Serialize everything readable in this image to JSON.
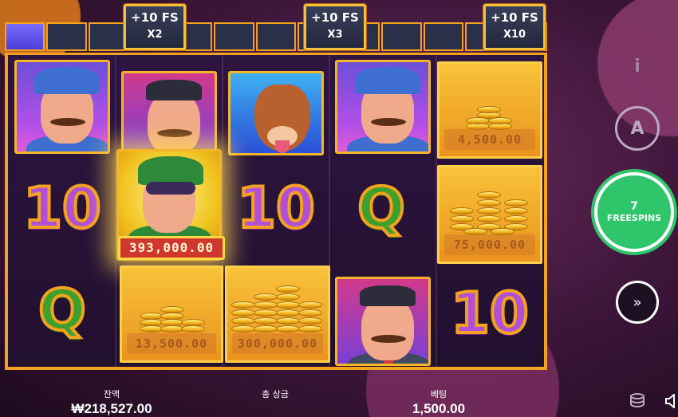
{
  "progress": {
    "filled_cells": 1,
    "total_cells": 13,
    "badges": [
      {
        "label": "+10 FS",
        "multiplier": "X2"
      },
      {
        "label": "+10 FS",
        "multiplier": "X3"
      },
      {
        "label": "+10 FS",
        "multiplier": "X10"
      }
    ]
  },
  "reels": {
    "coin_values": {
      "r1c5": "4,500.00",
      "r2c5": "75,000.00",
      "r3c2": "13,500.00",
      "r3c3": "300,000.00"
    },
    "bonus_value": "393,000.00",
    "letters": {
      "ten": "10",
      "q": "Q"
    }
  },
  "controls": {
    "info": "i",
    "auto": "A",
    "freespins_count": "7",
    "freespins_label": "FREESPINS",
    "turbo": "»"
  },
  "footer": {
    "balance_label": "잔액",
    "balance_value": "₩218,527.00",
    "total_win_label": "총 상금",
    "total_win_value": "",
    "bet_label": "베팅",
    "bet_value": "1,500.00"
  },
  "colors": {
    "frame": "#f2a21e",
    "freespins_green": "#2fc56a",
    "bonus_plate": "#d0372c"
  }
}
